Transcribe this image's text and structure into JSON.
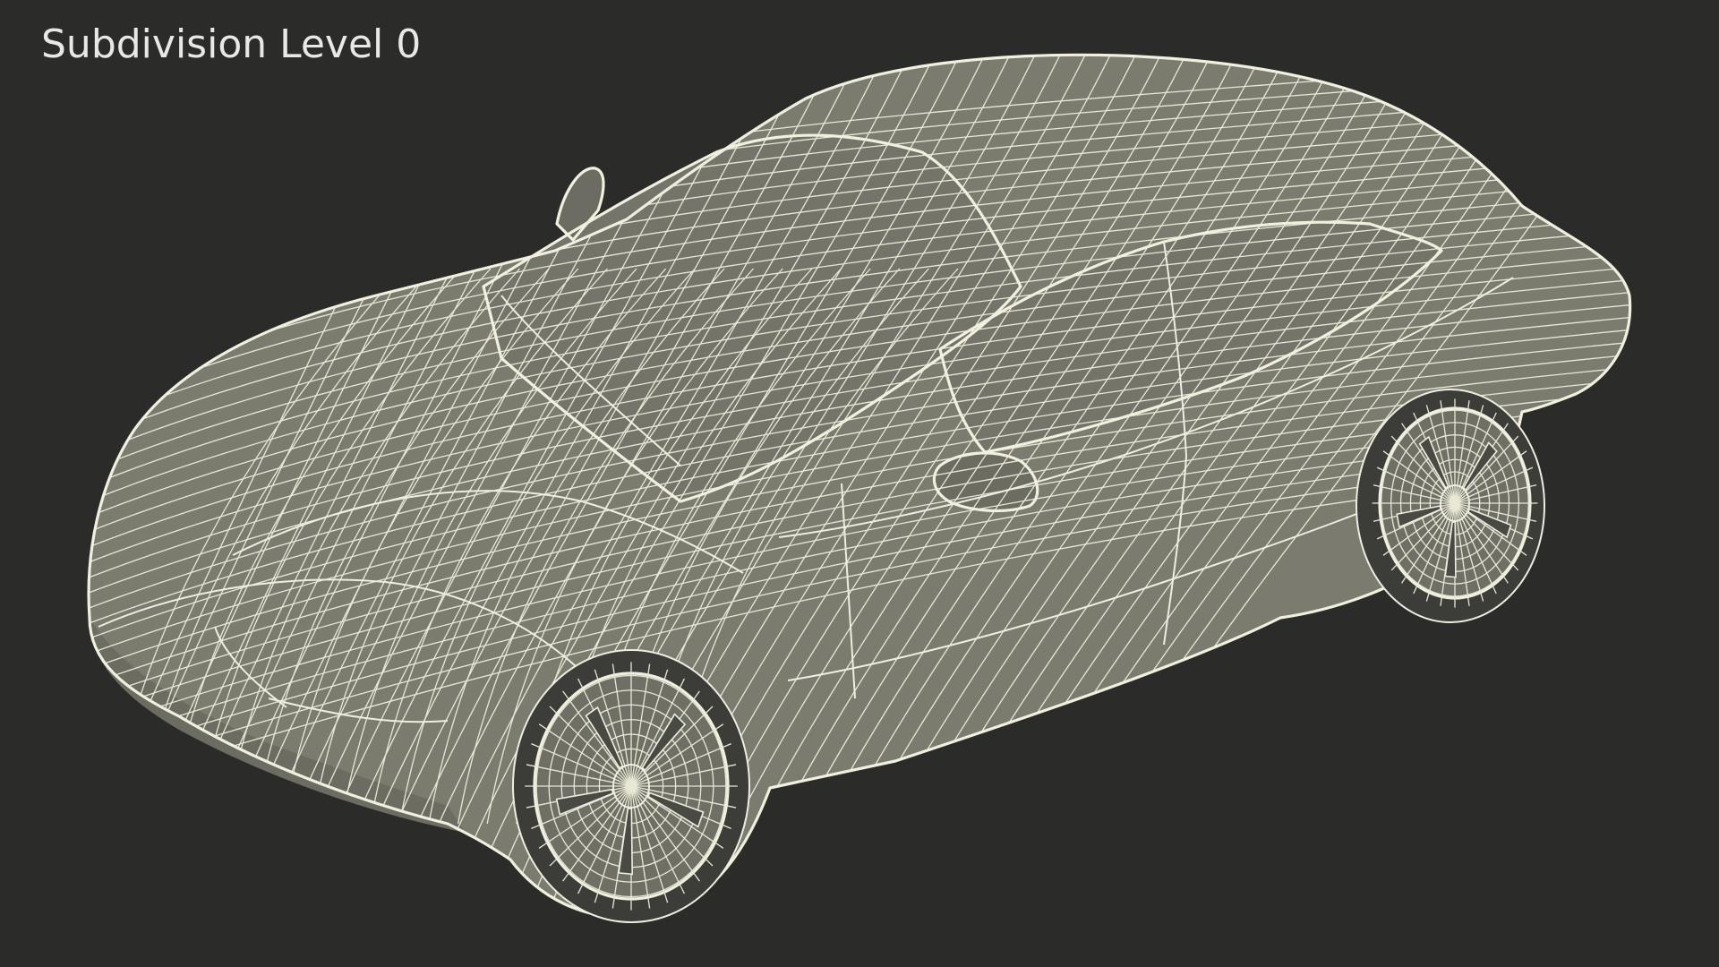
{
  "viewport": {
    "label": "Subdivision Level 0",
    "background": "#2b2b29",
    "mesh_color": "#7b7b70",
    "wire_color": "#e9e8d6"
  }
}
